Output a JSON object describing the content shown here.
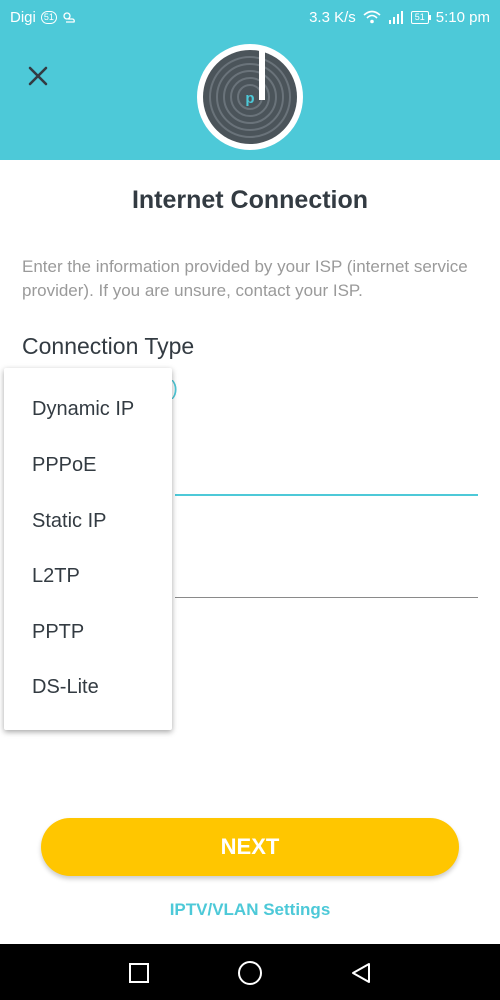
{
  "status_bar": {
    "carrier": "Digi",
    "sim_badge": "51",
    "speed": "3.3 K/s",
    "battery": "51",
    "time": "5:10 pm"
  },
  "page": {
    "title": "Internet Connection",
    "description": "Enter the information provided by your ISP (internet service provider). If you are unsure, contact your ISP.",
    "connection_type_label": "Connection Type",
    "connection_type_value_partial": "d)"
  },
  "dropdown": {
    "options": [
      "Dynamic IP",
      "PPPoE",
      "Static IP",
      "L2TP",
      "PPTP",
      "DS-Lite"
    ]
  },
  "actions": {
    "next_label": "NEXT",
    "iptv_label": "IPTV/VLAN Settings"
  },
  "colors": {
    "accent": "#4dc9d8",
    "button": "#ffc600",
    "text_dark": "#333b42",
    "text_muted": "#9a9a9a"
  },
  "icons": {
    "close": "close-icon",
    "logo": "deco-logo-icon",
    "wifi": "wifi-icon",
    "signal": "signal-icon",
    "nav_recent": "square-icon",
    "nav_home": "circle-icon",
    "nav_back": "triangle-back-icon"
  }
}
